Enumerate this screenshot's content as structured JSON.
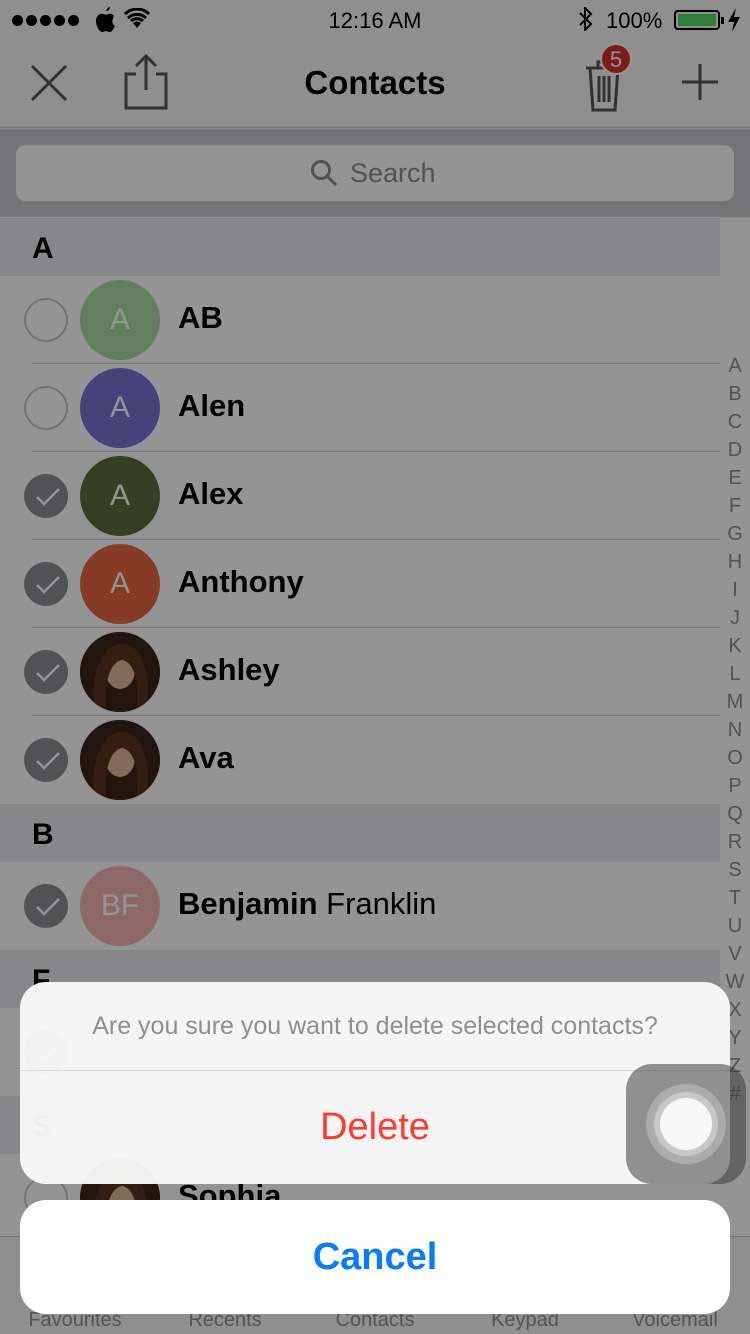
{
  "status": {
    "time": "12:16 AM",
    "battery_percent": "100%",
    "battery_level": 1.0,
    "battery_color": "#4cd964"
  },
  "navbar": {
    "title": "Contacts",
    "trash_badge": "5"
  },
  "search": {
    "placeholder": "Search",
    "value": ""
  },
  "sections": [
    {
      "letter": "A",
      "rows": [
        {
          "first": "AB",
          "last": "",
          "initials": "A",
          "color": "#a8d9a0",
          "avatar": "initial",
          "checked": false
        },
        {
          "first": "Alen",
          "last": "",
          "initials": "A",
          "color": "#7a72d3",
          "avatar": "initial",
          "checked": false
        },
        {
          "first": "Alex",
          "last": "",
          "initials": "A",
          "color": "#5d6d39",
          "avatar": "initial",
          "checked": true
        },
        {
          "first": "Anthony",
          "last": "",
          "initials": "A",
          "color": "#e3693e",
          "avatar": "initial",
          "checked": true
        },
        {
          "first": "Ashley",
          "last": "",
          "initials": "",
          "color": "#5b3a2a",
          "avatar": "photo",
          "checked": true
        },
        {
          "first": "Ava",
          "last": "",
          "initials": "",
          "color": "#4a2f22",
          "avatar": "photo",
          "checked": true
        }
      ]
    },
    {
      "letter": "B",
      "rows": [
        {
          "first": "Benjamin",
          "last": "Franklin",
          "initials": "BF",
          "color": "#f4b3b3",
          "avatar": "initial",
          "checked": true
        }
      ]
    },
    {
      "letter": "F",
      "rows": [
        {
          "first": "",
          "last": "",
          "initials": "",
          "color": "#cccccc",
          "avatar": "initial",
          "checked": true
        }
      ]
    },
    {
      "letter": "S",
      "rows": [
        {
          "first": "Sophia",
          "last": "",
          "initials": "",
          "color": "#4a2f22",
          "avatar": "photo",
          "checked": false
        }
      ]
    }
  ],
  "index_letters": [
    "A",
    "B",
    "C",
    "D",
    "E",
    "F",
    "G",
    "H",
    "I",
    "J",
    "K",
    "L",
    "M",
    "N",
    "O",
    "P",
    "Q",
    "R",
    "S",
    "T",
    "U",
    "V",
    "W",
    "X",
    "Y",
    "Z",
    "#"
  ],
  "tabs": [
    "Favourites",
    "Recents",
    "Contacts",
    "Keypad",
    "Voicemail"
  ],
  "action_sheet": {
    "message": "Are you sure you want to delete selected contacts?",
    "delete_label": "Delete",
    "cancel_label": "Cancel"
  }
}
